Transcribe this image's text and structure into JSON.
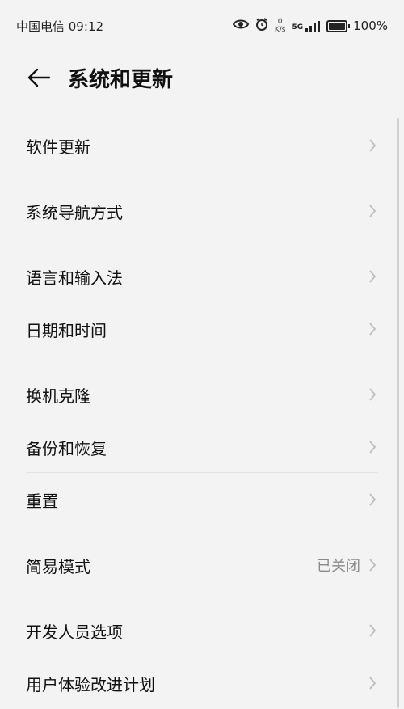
{
  "status": {
    "carrier_time": "中国电信 09:12",
    "speed_value": "0",
    "speed_unit": "K/s",
    "network": "5G",
    "battery": "100%"
  },
  "header": {
    "title": "系统和更新"
  },
  "items": [
    {
      "label": "软件更新"
    },
    {
      "label": "系统导航方式"
    },
    {
      "label": "语言和输入法"
    },
    {
      "label": "日期和时间"
    },
    {
      "label": "换机克隆"
    },
    {
      "label": "备份和恢复"
    },
    {
      "label": "重置"
    },
    {
      "label": "简易模式",
      "value": "已关闭"
    },
    {
      "label": "开发人员选项"
    },
    {
      "label": "用户体验改进计划"
    }
  ]
}
